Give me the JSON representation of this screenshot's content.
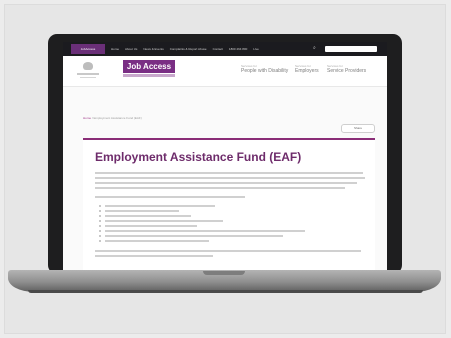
{
  "nav": {
    "brand": "JobAccess",
    "links": [
      "Home",
      "About Us",
      "News & Events",
      "Complaints & Report Abuse",
      "Contact",
      "1800 464 800",
      "Live"
    ],
    "search_icon": "search-icon"
  },
  "header": {
    "logo_text": "Job Access",
    "audiences": [
      {
        "small": "Services for",
        "big": "People with Disability"
      },
      {
        "small": "Services for",
        "big": "Employers"
      },
      {
        "small": "Services for",
        "big": "Service Providers"
      }
    ]
  },
  "breadcrumb": {
    "home": "Home",
    "current": " / Employment Assistance Fund (EAF)"
  },
  "share_label": "Share",
  "article": {
    "title": "Employment Assistance Fund (EAF)"
  },
  "colors": {
    "brand": "#7a2e84",
    "accent": "#8a2d77",
    "nav_bg": "#1b1b1f"
  }
}
